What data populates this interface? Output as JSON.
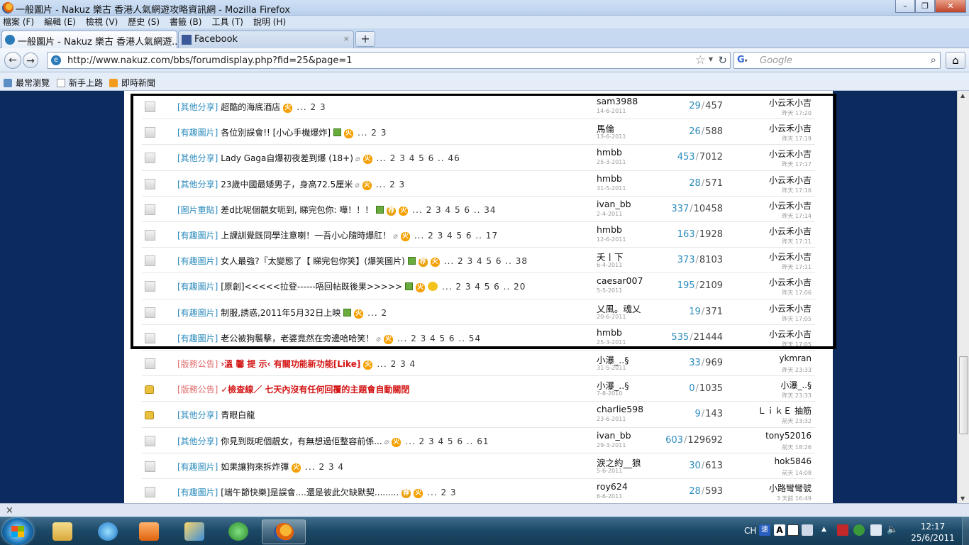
{
  "window": {
    "title": "一般圖片 - Nakuz 樂古 香港人氣網遊攻略資訊網 - Mozilla Firefox",
    "controls": [
      "–",
      "❐",
      "✕"
    ]
  },
  "menu": [
    "檔案 (F)",
    "編輯 (E)",
    "檢視 (V)",
    "歷史 (S)",
    "書籤 (B)",
    "工具 (T)",
    "說明 (H)"
  ],
  "tabs": [
    {
      "label": "一般圖片 - Nakuz 樂古 香港人氣網遊...",
      "close": "×"
    },
    {
      "label": "Facebook",
      "close": "×"
    }
  ],
  "newtab": "+",
  "nav": {
    "back": "←",
    "forward": "→",
    "url": "http://www.nakuz.com/bbs/forumdisplay.php?fid=25&page=1",
    "search_placeholder": "Google",
    "home": "⌂"
  },
  "bookmarks": [
    "最常瀏覽",
    "新手上路",
    "即時新聞"
  ],
  "threads": [
    {
      "icon": "doc",
      "category": "[其他分享]",
      "title": "超酷的海底酒店",
      "badges": [
        "hot"
      ],
      "pages": "... 2 3",
      "author": "sam3988",
      "date": "14-6-2011",
      "replies": "29",
      "views": "457",
      "last_user": "小云禾小吉",
      "last_time": "昨天 17:20"
    },
    {
      "icon": "doc",
      "category": "[有趣圖片]",
      "title": "各位別誤會!! [小心手機爆炸]",
      "badges": [
        "img",
        "hot"
      ],
      "pages": "... 2 3",
      "author": "馬倫",
      "date": "13-6-2011",
      "replies": "26",
      "views": "588",
      "last_user": "小云禾小吉",
      "last_time": "昨天 17:19"
    },
    {
      "icon": "doc",
      "category": "[其他分享]",
      "title": "Lady Gaga自爆初夜差到爆 (18+)",
      "badges": [
        "attach",
        "hot"
      ],
      "pages": "... 2 3 4 5 6 .. 46",
      "author": "hmbb",
      "date": "25-3-2011",
      "replies": "453",
      "views": "7012",
      "last_user": "小云禾小吉",
      "last_time": "昨天 17:17"
    },
    {
      "icon": "doc",
      "category": "[其他分享]",
      "title": "23歲中國最矮男子，身高72.5厘米",
      "badges": [
        "attach",
        "hot"
      ],
      "pages": "... 2 3",
      "author": "hmbb",
      "date": "31-5-2011",
      "replies": "28",
      "views": "571",
      "last_user": "小云禾小吉",
      "last_time": "昨天 17:16"
    },
    {
      "icon": "doc",
      "category": "[圖片重貼]",
      "title": "差d比呢個靚女呃到, 睇完包你: 嘩！！！",
      "badges": [
        "img",
        "rec",
        "hot"
      ],
      "pages": "... 2 3 4 5 6 .. 34",
      "author": "ivan_bb",
      "date": "2-4-2011",
      "replies": "337",
      "views": "10458",
      "last_user": "小云禾小吉",
      "last_time": "昨天 17:14"
    },
    {
      "icon": "doc",
      "category": "[有趣圖片]",
      "title": "上課訓覺既同學注意喇！一吾小心隨時爆肛！",
      "badges": [
        "attach",
        "hot"
      ],
      "pages": "... 2 3 4 5 6 .. 17",
      "author": "hmbb",
      "date": "12-6-2011",
      "replies": "163",
      "views": "1928",
      "last_user": "小云禾小吉",
      "last_time": "昨天 17:11"
    },
    {
      "icon": "doc",
      "category": "[有趣圖片]",
      "title": "女人最強?『太變態了【 睇完包你笑】(爆笑圖片)",
      "badges": [
        "img",
        "rec",
        "hot"
      ],
      "pages": "... 2 3 4 5 6 .. 38",
      "author": "夭丨下",
      "date": "6-4-2011",
      "replies": "373",
      "views": "8103",
      "last_user": "小云禾小吉",
      "last_time": "昨天 17:11"
    },
    {
      "icon": "doc",
      "category": "[有趣圖片]",
      "title": "[原創]<<<<<拉登------唔回帖既後果>>>>>",
      "badges": [
        "img",
        "hot",
        "smile"
      ],
      "pages": "... 2 3 4 5 6 .. 20",
      "author": "caesar007",
      "date": "5-5-2011",
      "replies": "195",
      "views": "2109",
      "last_user": "小云禾小吉",
      "last_time": "昨天 17:06"
    },
    {
      "icon": "doc",
      "category": "[有趣圖片]",
      "title": "制服,誘惑,2011年5月32日上映",
      "badges": [
        "img",
        "hot"
      ],
      "pages": "... 2",
      "author": "乂風。魂乂",
      "date": "20-6-2011",
      "replies": "19",
      "views": "371",
      "last_user": "小云禾小吉",
      "last_time": "昨天 17:05"
    },
    {
      "icon": "doc",
      "category": "[有趣圖片]",
      "title": "老公被狗襲擊，老婆竟然在旁邊哈哈笑！",
      "badges": [
        "attach",
        "hot"
      ],
      "pages": "... 2 3 4 5 6 .. 54",
      "author": "hmbb",
      "date": "25-3-2011",
      "replies": "535",
      "views": "21444",
      "last_user": "小云禾小吉",
      "last_time": "昨天 17:05"
    },
    {
      "icon": "doc",
      "category": "[版務公告]",
      "category_red": true,
      "title": "›溫 馨 提 示‹  有關功能新功能[Like]",
      "title_red": true,
      "badges": [
        "hot"
      ],
      "pages": "... 2 3 4",
      "author": "小瀑_..§",
      "date": "31-5-2011",
      "replies": "33",
      "views": "969",
      "last_user": "ykmran",
      "last_time": "昨天 23:33"
    },
    {
      "icon": "lock",
      "category": "[版務公告]",
      "category_red": true,
      "title": "✓檢查線／ 七天內沒有任何回覆的主題會自動關閉",
      "title_red": true,
      "badges": [],
      "pages": "",
      "author": "小瀑_..§",
      "date": "7-8-2010",
      "replies": "0",
      "views": "1035",
      "last_user": "小瀑_..§",
      "last_time": "昨天 23:33"
    },
    {
      "icon": "lock",
      "category": "[其他分享]",
      "title": "青眼白龍",
      "badges": [],
      "pages": "",
      "author": "charlie598",
      "date": "23-6-2011",
      "replies": "9",
      "views": "143",
      "last_user": "ＬｉｋＥ 抽筋",
      "last_time": "前天 23:32"
    },
    {
      "icon": "doc",
      "category": "[其他分享]",
      "title": "你見到既呢個靚女，有無想過佢整容前係...",
      "badges": [
        "attach",
        "hot"
      ],
      "pages": "... 2 3 4 5 6 .. 61",
      "author": "ivan_bb",
      "date": "29-3-2011",
      "replies": "603",
      "views": "129692",
      "last_user": "tony52016",
      "last_time": "前天 18:26"
    },
    {
      "icon": "doc",
      "category": "[有趣圖片]",
      "title": "如果讓狗來拆炸彈",
      "badges": [
        "hot"
      ],
      "pages": "... 2 3 4",
      "author": "淚之約__狼",
      "date": "5-6-2011",
      "replies": "30",
      "views": "613",
      "last_user": "hok5846",
      "last_time": "前天 14:08"
    },
    {
      "icon": "doc",
      "category": "[有趣圖片]",
      "title": "[端午節快樂]是誤會....還是彼此欠缺默契.........",
      "badges": [
        "rec",
        "hot"
      ],
      "pages": "... 2 3",
      "author": "roy624",
      "date": "6-6-2011",
      "replies": "28",
      "views": "593",
      "last_user": "小路彎彎號",
      "last_time": "3 天前 16:49"
    }
  ],
  "badge_text": {
    "hot": "火",
    "rec": "荐"
  },
  "statusbar": {
    "close": "×"
  },
  "taskbar": {
    "language": "CH",
    "time": "12:17",
    "date": "25/6/2011"
  }
}
